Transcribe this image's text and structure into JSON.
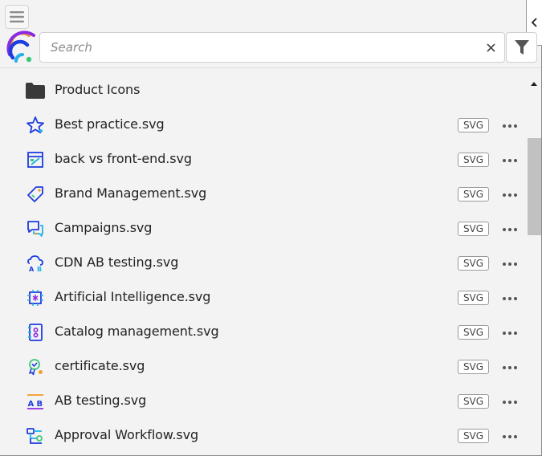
{
  "search": {
    "placeholder": "Search",
    "value": ""
  },
  "folder": {
    "label": "Product Icons"
  },
  "file_badge": "SVG",
  "files": [
    {
      "name": "Best practice.svg",
      "icon": "star-icon",
      "type": "SVG"
    },
    {
      "name": "back vs front-end.svg",
      "icon": "code-window-icon",
      "type": "SVG"
    },
    {
      "name": "Brand Management.svg",
      "icon": "tag-icon",
      "type": "SVG"
    },
    {
      "name": "Campaigns.svg",
      "icon": "chat-bubbles-icon",
      "type": "SVG"
    },
    {
      "name": "CDN AB testing.svg",
      "icon": "cloud-ab-icon",
      "type": "SVG"
    },
    {
      "name": "Artificial Intelligence.svg",
      "icon": "chip-icon",
      "type": "SVG"
    },
    {
      "name": "Catalog management.svg",
      "icon": "catalog-icon",
      "type": "SVG"
    },
    {
      "name": "certificate.svg",
      "icon": "certificate-icon",
      "type": "SVG"
    },
    {
      "name": "AB testing.svg",
      "icon": "ab-test-icon",
      "type": "SVG"
    },
    {
      "name": "Approval Workflow.svg",
      "icon": "workflow-icon",
      "type": "SVG"
    }
  ],
  "colors": {
    "accent_blue": "#1f3ce0",
    "accent_cyan": "#21b3e8",
    "accent_green": "#3cc87a",
    "accent_orange": "#f59a23",
    "accent_purple": "#8a2be2"
  }
}
